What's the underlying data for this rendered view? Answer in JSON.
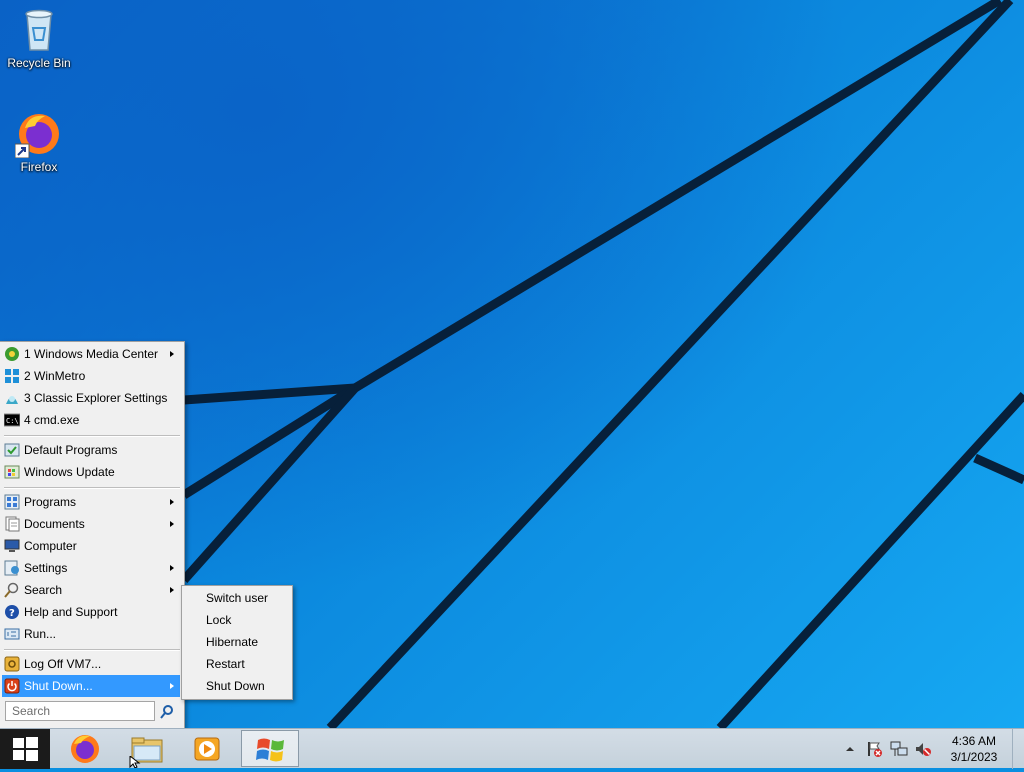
{
  "desktop": {
    "icons": [
      {
        "label": "Recycle Bin",
        "icon": "recycle-bin-icon"
      },
      {
        "label": "Firefox",
        "icon": "firefox-icon"
      }
    ]
  },
  "start_menu": {
    "recent": [
      {
        "label": "1 Windows Media Center",
        "icon": "windows-media-center-icon",
        "submenu": true
      },
      {
        "label": "2 WinMetro",
        "icon": "winmetro-icon",
        "submenu": false
      },
      {
        "label": "3 Classic Explorer Settings",
        "icon": "classic-explorer-icon",
        "submenu": false
      },
      {
        "label": "4 cmd.exe",
        "icon": "cmd-icon",
        "submenu": false
      }
    ],
    "pinned": [
      {
        "label": "Default Programs",
        "icon": "default-programs-icon"
      },
      {
        "label": "Windows Update",
        "icon": "windows-update-icon"
      }
    ],
    "main": [
      {
        "label": "Programs",
        "icon": "programs-icon",
        "submenu": true
      },
      {
        "label": "Documents",
        "icon": "documents-icon",
        "submenu": true
      },
      {
        "label": "Computer",
        "icon": "computer-icon",
        "submenu": false
      },
      {
        "label": "Settings",
        "icon": "settings-icon",
        "submenu": true
      },
      {
        "label": "Search",
        "icon": "search-icon",
        "submenu": true
      },
      {
        "label": "Help and Support",
        "icon": "help-icon",
        "submenu": false
      },
      {
        "label": "Run...",
        "icon": "run-icon",
        "submenu": false
      }
    ],
    "logoff": {
      "label": "Log Off VM7...",
      "icon": "logoff-icon"
    },
    "shutdown": {
      "label": "Shut Down...",
      "icon": "shutdown-icon"
    },
    "search_placeholder": "Search"
  },
  "shutdown_submenu": [
    "Switch user",
    "Lock",
    "Hibernate",
    "Restart",
    "Shut Down"
  ],
  "taskbar": {
    "buttons": [
      {
        "icon": "firefox-icon"
      },
      {
        "icon": "file-explorer-icon"
      },
      {
        "icon": "media-player-icon"
      },
      {
        "icon": "windows-flag-icon",
        "active": true
      }
    ],
    "clock": {
      "time": "4:36 AM",
      "date": "3/1/2023"
    }
  },
  "colors": {
    "highlight": "#3399ff",
    "menu_bg": "#f0f0f0",
    "taskbar_bg": "#c9d5df"
  }
}
